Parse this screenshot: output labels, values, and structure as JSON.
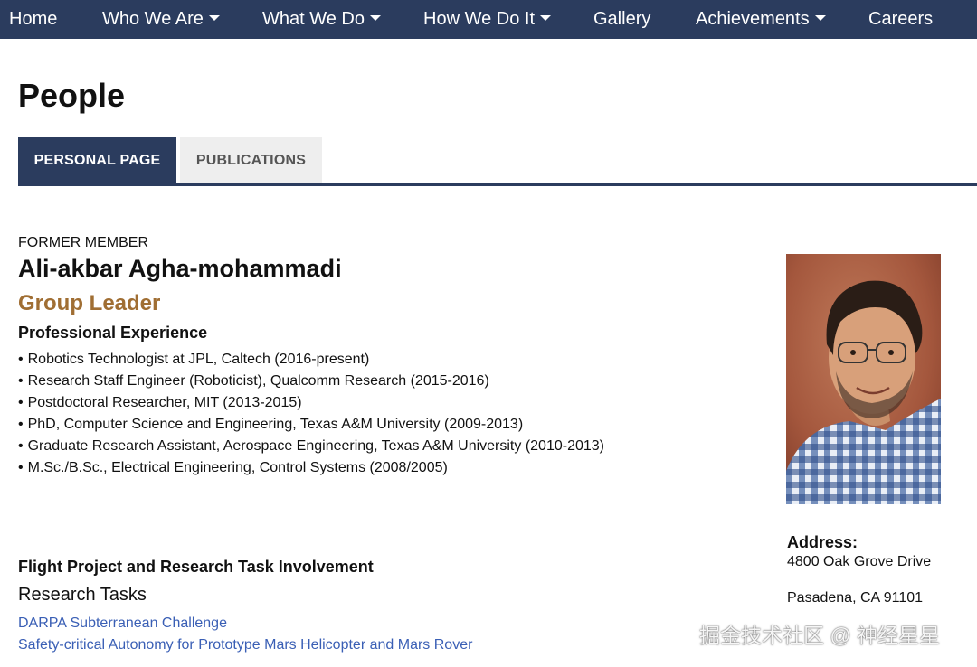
{
  "nav": {
    "items": [
      {
        "label": "Home",
        "dropdown": false
      },
      {
        "label": "Who We Are",
        "dropdown": true
      },
      {
        "label": "What We Do",
        "dropdown": true
      },
      {
        "label": "How We Do It",
        "dropdown": true
      },
      {
        "label": "Gallery",
        "dropdown": false
      },
      {
        "label": "Achievements",
        "dropdown": true
      },
      {
        "label": "Careers",
        "dropdown": false
      }
    ]
  },
  "page": {
    "title": "People"
  },
  "tabs": [
    {
      "label": "PERSONAL PAGE",
      "active": true
    },
    {
      "label": "PUBLICATIONS",
      "active": false
    }
  ],
  "profile": {
    "status": "FORMER MEMBER",
    "name": "Ali-akbar Agha-mohammadi",
    "role": "Group Leader",
    "experience_heading": "Professional Experience",
    "experience": [
      "Robotics Technologist at JPL, Caltech (2016-present)",
      "Research Staff Engineer (Roboticist), Qualcomm Research (2015-2016)",
      "Postdoctoral Researcher, MIT (2013-2015)",
      "PhD, Computer Science and Engineering, Texas A&M University (2009-2013)",
      "Graduate Research Assistant, Aerospace Engineering, Texas A&M University (2010-2013)",
      "M.Sc./B.Sc., Electrical Engineering, Control Systems (2008/2005)"
    ],
    "involvement_heading": "Flight Project and Research Task Involvement",
    "research_tasks_heading": "Research Tasks",
    "research_tasks": [
      "DARPA Subterranean Challenge",
      "Safety-critical Autonomy for Prototype Mars Helicopter and Mars Rover"
    ]
  },
  "address": {
    "label": "Address:",
    "line1": "4800 Oak Grove Drive",
    "line2": "Pasadena, CA 91101"
  },
  "watermark": "掘金技术社区 @ 神经星星",
  "colors": {
    "nav_bg": "#2b3c5e",
    "accent_role": "#a06e33",
    "link": "#3a5fb5",
    "tab_inactive_bg": "#eeeeee"
  }
}
